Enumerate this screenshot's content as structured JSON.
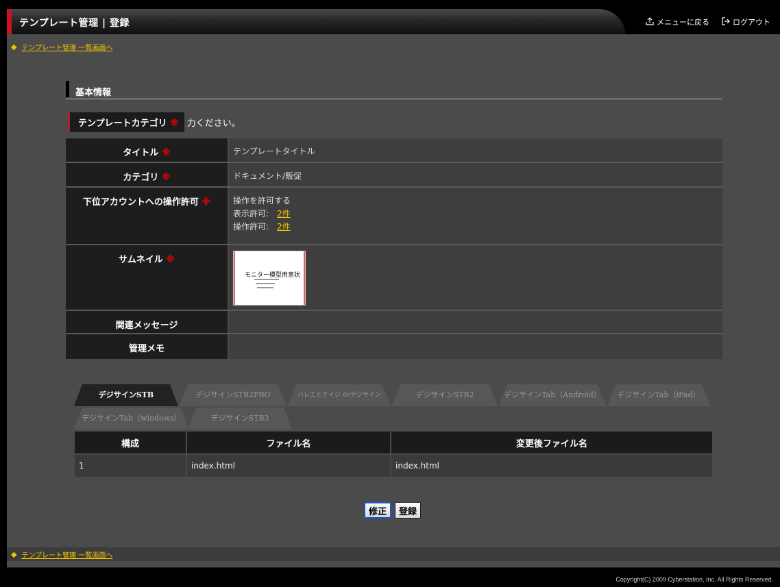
{
  "header": {
    "title": "テンプレート管理 | 登録",
    "menu_back": "メニューに戻る",
    "logout": "ログアウト"
  },
  "back_link": "テンプレート管理 一覧画面へ",
  "section": {
    "title": "基本情報"
  },
  "category_prompt": {
    "label": "テンプレートカテゴリ",
    "required_mark": "※",
    "suffix": "力ください。"
  },
  "info": {
    "title": {
      "label": "タイトル",
      "req": "※",
      "value": "テンプレートタイトル"
    },
    "category": {
      "label": "カテゴリ",
      "req": "※",
      "value": "ドキュメント/販促"
    },
    "permission": {
      "label": "下位アカウントへの操作許可",
      "req": "※",
      "value": "操作を許可する",
      "display_label": "表示許可:",
      "display_count": "2件",
      "operate_label": "操作許可:",
      "operate_count": "2件"
    },
    "thumbnail": {
      "label": "サムネイル",
      "req": "※",
      "image_text": "モニター模型用意状"
    },
    "related_message": {
      "label": "関連メッセージ",
      "value": ""
    },
    "memo": {
      "label": "管理メモ",
      "value": ""
    }
  },
  "tabs": [
    "デジサインSTB",
    "デジサインSTB2PRO",
    "ハレエとケイジ deデジサイン",
    "デジサインSTB2",
    "デジサインTab（Android）",
    "デジサインTab（iPad）",
    "デジサインTab（windows）",
    "デジサインSTB3"
  ],
  "file_table": {
    "headers": [
      "構成",
      "ファイル名",
      "変更後ファイル名"
    ],
    "rows": [
      [
        "1",
        "index.html",
        "index.html"
      ]
    ]
  },
  "buttons": {
    "edit": "修正",
    "register": "登録"
  },
  "footer": {
    "copyright": "Copyright(C) 2009 Cyberstation, Inc. All Rights Reserved."
  },
  "colors": {
    "accent_red": "#c8141e",
    "link_yellow": "#f5c400",
    "button_focus": "#1b55c8"
  }
}
